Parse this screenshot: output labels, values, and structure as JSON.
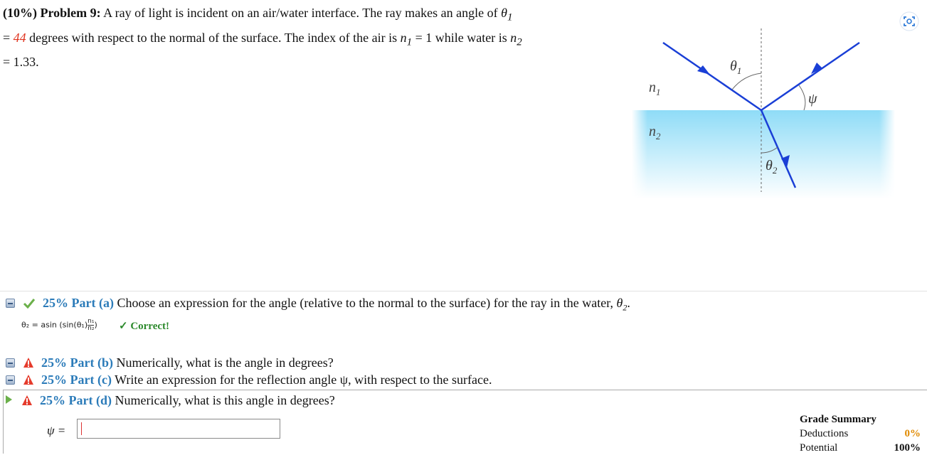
{
  "problem": {
    "header": "(10%)  Problem 9:",
    "text1": "A ray of light is incident on an air/water interface. The ray makes an angle of",
    "theta1": "θ",
    "theta1_sub": "1",
    "eq1": "=",
    "theta_value": "44",
    "text2": "degrees with respect to the normal of the surface. The index of the air is",
    "n1": "n",
    "n1_sub": "1",
    "text3": "= 1 while water is",
    "n2": "n",
    "n2_sub": "2",
    "text4": "= 1.33."
  },
  "diagram": {
    "n1_label": "n",
    "n1_sub": "1",
    "n2_label": "n",
    "n2_sub": "2",
    "theta1_label": "θ",
    "theta1_sub": "1",
    "theta2_label": "θ",
    "theta2_sub": "2",
    "psi_label": "ψ"
  },
  "parts": {
    "a": {
      "pct": "25% Part (a)",
      "text": "Choose an expression for the angle (relative to the normal to the surface) for the ray in the water,",
      "tail": "θ",
      "tail_sub": "2",
      "tail_end": ".",
      "formula": "θ₂ = asin (sin(θ₁)",
      "frac_num": "n₁",
      "frac_den": "n₂",
      "formula_end": ")",
      "status": "✓ Correct!"
    },
    "b": {
      "pct": "25% Part (b)",
      "text": "Numerically, what is the angle in degrees?"
    },
    "c": {
      "pct": "25% Part (c)",
      "text": "Write an expression for the reflection angle ψ, with respect to the surface."
    },
    "d": {
      "pct": "25% Part (d)",
      "text": "Numerically, what is this angle in degrees?"
    }
  },
  "answer": {
    "label": "ψ =",
    "value": ""
  },
  "grade": {
    "title": "Grade Summary",
    "deductions_label": "Deductions",
    "deductions_value": "0%",
    "potential_label": "Potential",
    "potential_value": "100%"
  },
  "icons": [
    "screenshot-icon",
    "collapse-icon",
    "check-icon",
    "warning-icon",
    "play-icon"
  ],
  "colors": {
    "accent": "#2b7bb9",
    "given_value": "#e0331e",
    "correct": "#2d8a2d",
    "water": "#8fdcf7",
    "ray": "#1a3fd6"
  }
}
